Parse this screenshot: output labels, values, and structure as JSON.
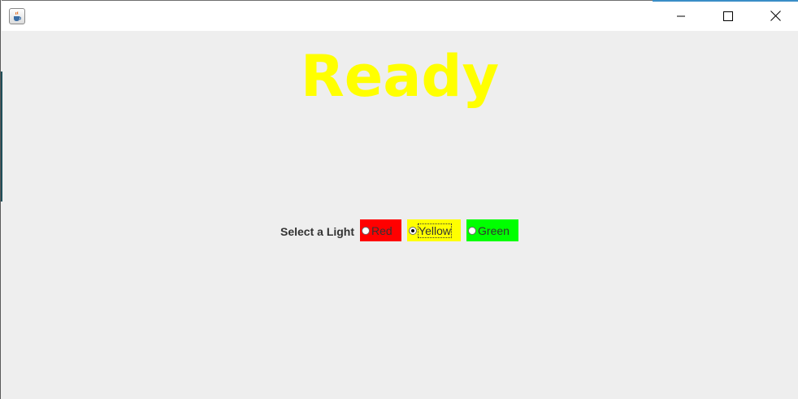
{
  "window": {
    "icon": "java-cup-icon",
    "controls": [
      "minimize-icon",
      "maximize-icon",
      "close-icon"
    ]
  },
  "status": {
    "text": "Ready",
    "color": "#ffff00"
  },
  "selector": {
    "label": "Select a Light",
    "options": [
      {
        "label": "Red",
        "color": "#ff0000",
        "selected": false
      },
      {
        "label": "Yellow",
        "color": "#ffff00",
        "selected": true
      },
      {
        "label": "Green",
        "color": "#00ff00",
        "selected": false
      }
    ]
  }
}
